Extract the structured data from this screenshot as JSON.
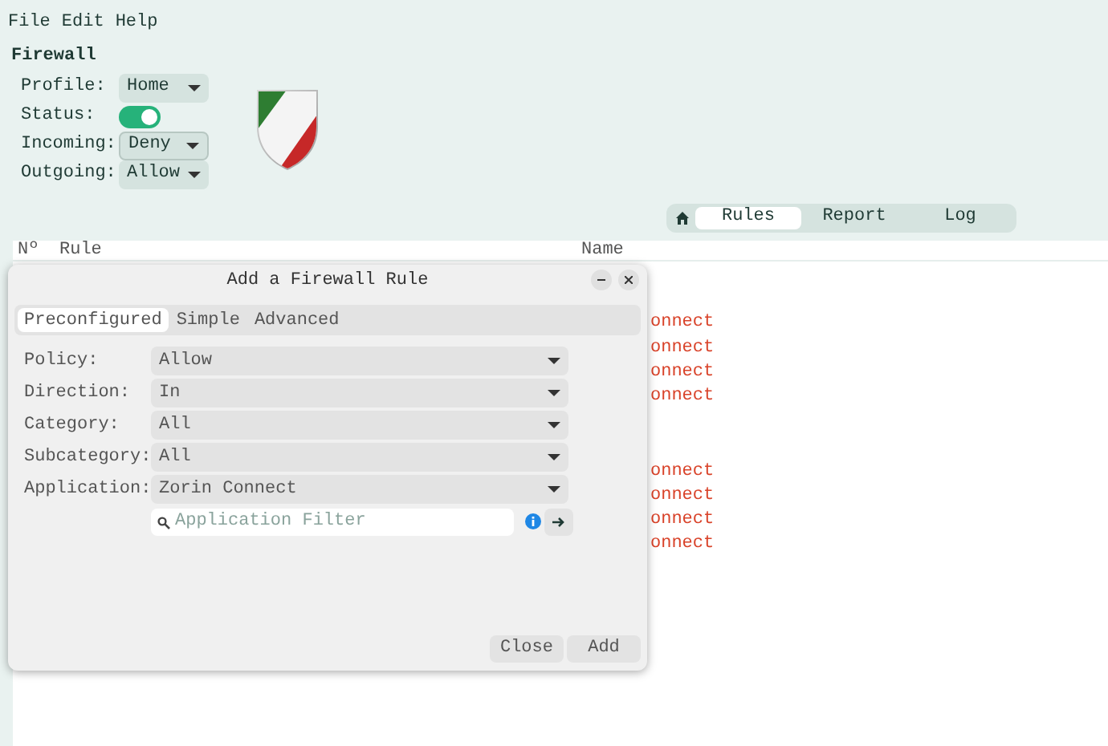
{
  "menu": [
    "File",
    "Edit",
    "Help"
  ],
  "firewall": {
    "title": "Firewall",
    "fields": [
      {
        "kind": "combo",
        "label": "Profile:",
        "value": "Home",
        "focused": false
      },
      {
        "kind": "switch",
        "label": "Status:",
        "on": true
      },
      {
        "kind": "combo",
        "label": "Incoming:",
        "value": "Deny",
        "focused": true
      },
      {
        "kind": "combo",
        "label": "Outgoing:",
        "value": "Allow",
        "focused": false
      }
    ]
  },
  "view_tabs": [
    {
      "kind": "home",
      "selected": false
    },
    {
      "label": "Rules",
      "selected": true
    },
    {
      "label": "Report",
      "selected": false
    },
    {
      "label": "Log",
      "selected": false
    }
  ],
  "table": {
    "columns": [
      "Nº",
      "Rule",
      "Name"
    ],
    "row_groups": [
      [
        {
          "name": "onnect"
        },
        {
          "name": "onnect"
        },
        {
          "name": "onnect"
        },
        {
          "name": "onnect"
        }
      ],
      [
        {
          "name": "onnect"
        },
        {
          "name": "onnect"
        },
        {
          "name": "onnect"
        },
        {
          "name": "onnect"
        }
      ]
    ]
  },
  "dialog": {
    "title": "Add a Firewall Rule",
    "tabs": [
      {
        "label": "Preconfigured",
        "selected": true
      },
      {
        "label": "Simple",
        "selected": false
      },
      {
        "label": "Advanced",
        "selected": false
      }
    ],
    "fields": [
      {
        "label": "Policy:",
        "value": "Allow"
      },
      {
        "label": "Direction:",
        "value": "In"
      },
      {
        "label": "Category:",
        "value": "All"
      },
      {
        "label": "Subcategory:",
        "value": "All"
      },
      {
        "label": "Application:",
        "value": "Zorin Connect"
      }
    ],
    "filter": {
      "placeholder": "Application Filter"
    },
    "buttons": [
      "Close",
      "Add"
    ]
  }
}
